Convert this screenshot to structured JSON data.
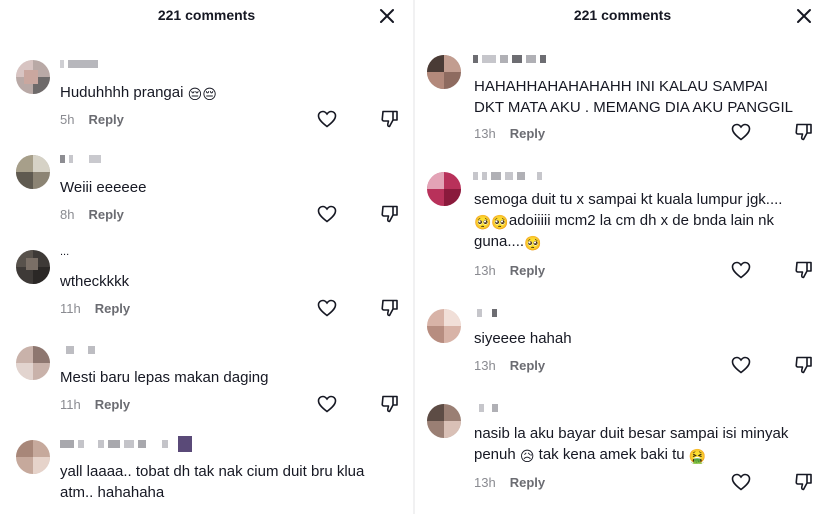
{
  "left": {
    "title": "221 comments",
    "comments": [
      {
        "text": "Huduhhhh prangai",
        "emoji": "😔😔",
        "time": "5h",
        "reply": "Reply"
      },
      {
        "text": "Weiii eeeeee",
        "time": "8h",
        "reply": "Reply"
      },
      {
        "username": "...",
        "text": "wtheckkkk",
        "time": "11h",
        "reply": "Reply"
      },
      {
        "text": "Mesti baru lepas makan daging",
        "time": "11h",
        "reply": "Reply"
      },
      {
        "text_line1": "yall laaaa.. tobat dh tak nak cium duit bru klua",
        "text_line2": "atm.. hahahaha"
      }
    ]
  },
  "right": {
    "title": "221 comments",
    "comments": [
      {
        "text_line1": "HAHAHHAHAHAHAHH INI KALAU SAMPAI",
        "text_line2": "DKT MATA AKU . MEMANG DIA AKU PANGGIL",
        "time": "13h",
        "reply": "Reply"
      },
      {
        "text_line1": "semoga duit tu x sampai kt kuala lumpur jgk....",
        "emoji_a": "🥺🥺",
        "text_line2": "adoiiiii mcm2 la cm dh x de bnda lain nk",
        "text_line3": "guna....",
        "emoji_b": "🥺",
        "time": "13h",
        "reply": "Reply"
      },
      {
        "text": "siyeeee hahah",
        "time": "13h",
        "reply": "Reply"
      },
      {
        "text_line1": "nasib la aku bayar duit besar sampai isi minyak",
        "text_line2a": "penuh",
        "emoji_a": "😥",
        "text_line2b": "tak kena amek baki tu",
        "emoji_b": "🤮",
        "time": "13h",
        "reply": "Reply"
      }
    ]
  },
  "colors": {
    "text": "#161823",
    "muted": "#8a8b91",
    "icon": "#161823"
  },
  "icons": [
    "close-icon",
    "heart-icon",
    "dislike-icon"
  ]
}
